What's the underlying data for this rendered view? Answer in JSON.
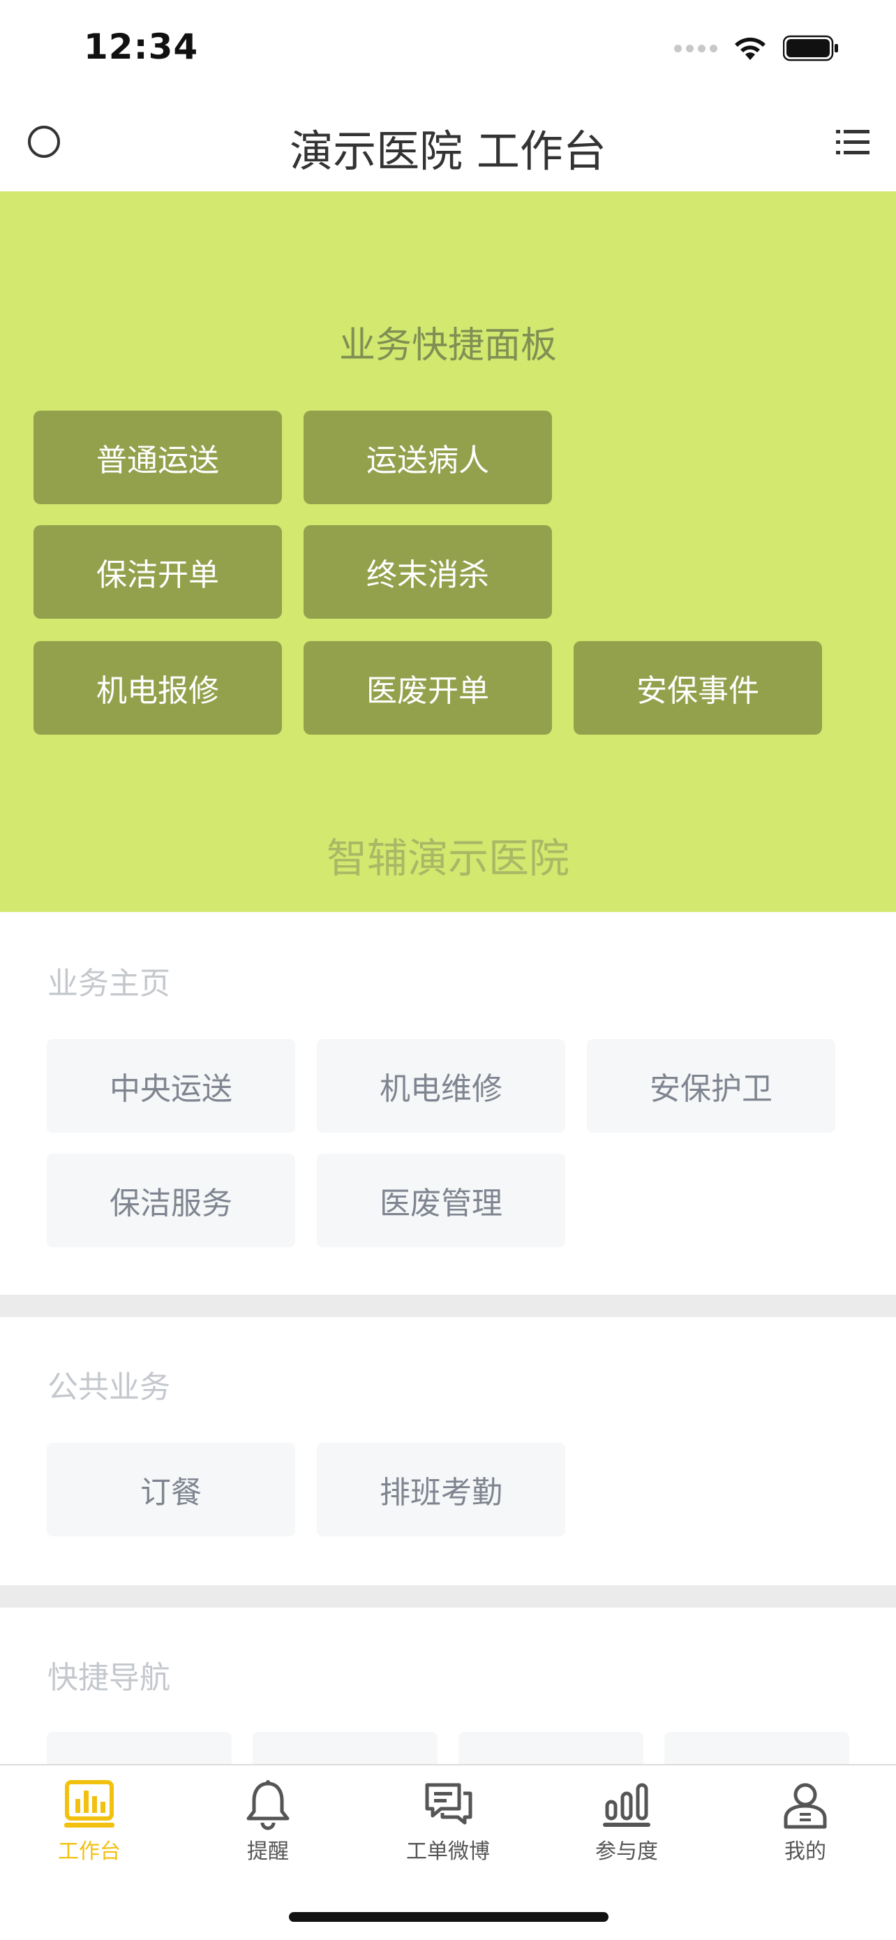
{
  "status": {
    "time": "12:34"
  },
  "nav": {
    "title": "演示医院 工作台"
  },
  "quick_panel": {
    "title": "业务快捷面板",
    "buttons": [
      "普通运送",
      "运送病人",
      "保洁开单",
      "终末消杀",
      "机电报修",
      "医废开单",
      "安保事件"
    ],
    "footer": "智辅演示医院",
    "background": "#d3e86f",
    "button_color": "#93a14d"
  },
  "business_home": {
    "title": "业务主页",
    "buttons": [
      "中央运送",
      "机电维修",
      "安保护卫",
      "保洁服务",
      "医废管理"
    ]
  },
  "public_business": {
    "title": "公共业务",
    "buttons": [
      "订餐",
      "排班考勤"
    ]
  },
  "quick_nav": {
    "title": "快捷导航"
  },
  "tabs": [
    {
      "label": "工作台",
      "icon": "dashboard-icon",
      "active": true
    },
    {
      "label": "提醒",
      "icon": "bell-icon",
      "active": false
    },
    {
      "label": "工单微博",
      "icon": "chat-icon",
      "active": false
    },
    {
      "label": "参与度",
      "icon": "bar-chart-icon",
      "active": false
    },
    {
      "label": "我的",
      "icon": "user-icon",
      "active": false
    }
  ],
  "accent_color": "#f2c10f"
}
